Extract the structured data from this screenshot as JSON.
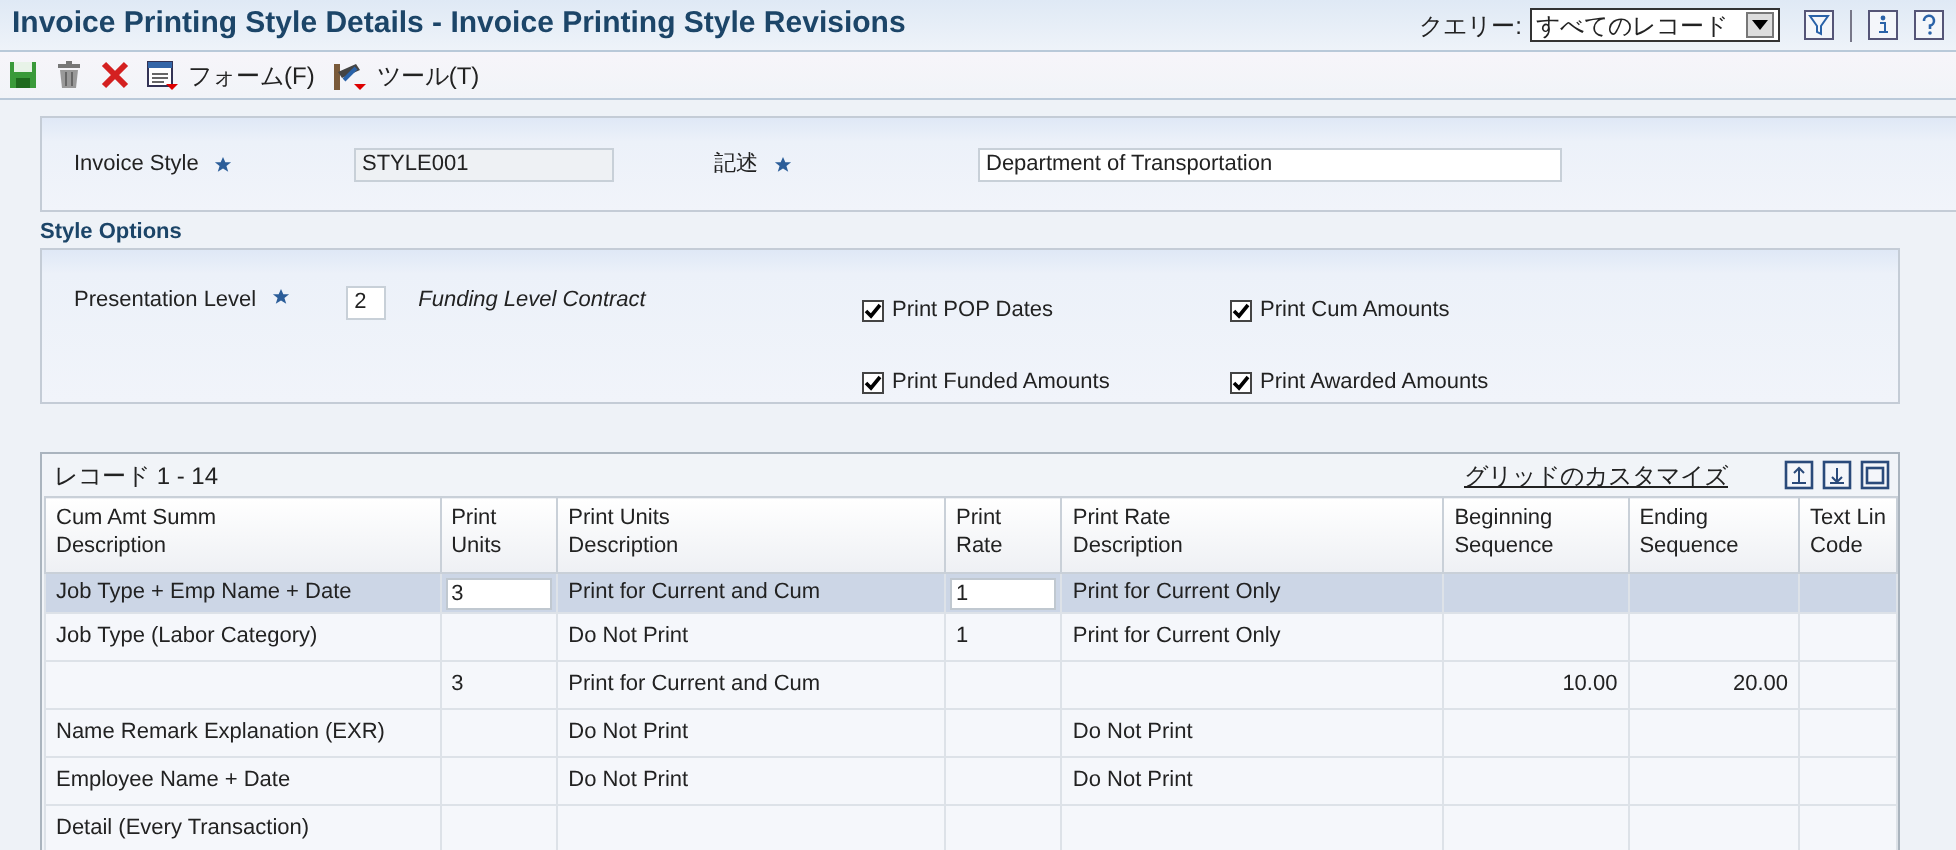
{
  "window": {
    "title": "Invoice Printing Style Details - Invoice Printing Style Revisions"
  },
  "query": {
    "label": "クエリー:",
    "value": "すべてのレコード"
  },
  "toolbar": [
    {
      "kind": "save"
    },
    {
      "kind": "delete"
    },
    {
      "kind": "cancel"
    },
    {
      "kind": "form",
      "label": "フォーム(F)"
    },
    {
      "kind": "tools",
      "label": "ツール(T)"
    }
  ],
  "header": {
    "fields": [
      {
        "label": "Invoice Style",
        "required": true,
        "value": "STYLE001",
        "disabled": true
      },
      {
        "label": "記述",
        "required": true,
        "value": "Department of Transportation",
        "disabled": false
      }
    ]
  },
  "style_options": {
    "title": "Style Options",
    "presentation_level": {
      "label": "Presentation Level",
      "required": true,
      "value": "2",
      "description": "Funding Level Contract"
    },
    "checkboxes": [
      {
        "label": "Print POP Dates",
        "checked": true
      },
      {
        "label": "Print Cum Amounts",
        "checked": true
      },
      {
        "label": "Print Funded Amounts",
        "checked": true
      },
      {
        "label": "Print Awarded Amounts",
        "checked": true
      }
    ]
  },
  "grid": {
    "records": "レコード 1 - 14",
    "customize": "グリッドのカスタマイズ",
    "columns": [
      {
        "lines": [
          "Cum Amt Summ",
          "Description"
        ],
        "kind": "text"
      },
      {
        "lines": [
          "Print",
          "Units"
        ],
        "kind": "entry"
      },
      {
        "lines": [
          "Print Units",
          "Description"
        ],
        "kind": "text"
      },
      {
        "lines": [
          "Print",
          "Rate"
        ],
        "kind": "entry"
      },
      {
        "lines": [
          "Print Rate",
          "Description"
        ],
        "kind": "text"
      },
      {
        "lines": [
          "Beginning",
          "Sequence"
        ],
        "kind": "number"
      },
      {
        "lines": [
          "Ending",
          "Sequence"
        ],
        "kind": "number"
      },
      {
        "lines": [
          "Text Lin",
          "Code"
        ],
        "kind": "text"
      }
    ],
    "rows": [
      {
        "selected": true,
        "cells": [
          "Job Type + Emp Name + Date",
          "3",
          "Print for Current and Cum",
          "1",
          "Print for Current Only",
          "",
          "",
          ""
        ]
      },
      {
        "selected": false,
        "cells": [
          "Job Type (Labor Category)",
          "",
          "Do Not Print",
          "1",
          "Print for Current Only",
          "",
          "",
          ""
        ]
      },
      {
        "selected": false,
        "cells": [
          "",
          "3",
          "Print for Current and Cum",
          "",
          "",
          "10.00",
          "20.00",
          ""
        ]
      },
      {
        "selected": false,
        "cells": [
          "Name Remark Explanation (EXR)",
          "",
          "Do Not Print",
          "",
          "Do Not Print",
          "",
          "",
          ""
        ]
      },
      {
        "selected": false,
        "cells": [
          "Employee Name + Date",
          "",
          "Do Not Print",
          "",
          "Do Not Print",
          "",
          "",
          ""
        ]
      },
      {
        "selected": false,
        "cells": [
          "Detail (Every Transaction)",
          "",
          "",
          "",
          "",
          "",
          "",
          ""
        ]
      }
    ]
  }
}
